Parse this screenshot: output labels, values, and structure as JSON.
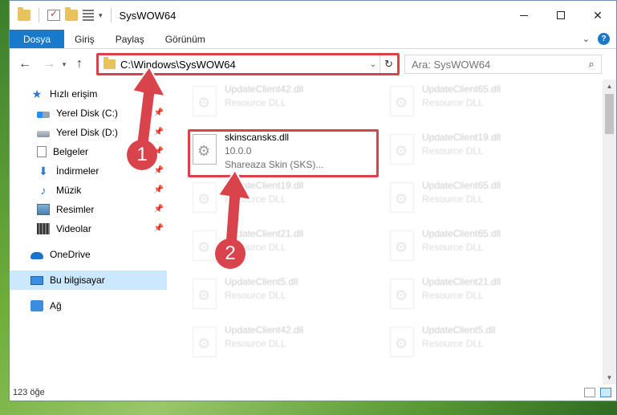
{
  "window": {
    "title": "SysWOW64",
    "controls": {
      "minimize": "–",
      "maximize": "□",
      "close": "✕"
    }
  },
  "ribbon": {
    "tabs": [
      "Dosya",
      "Giriş",
      "Paylaş",
      "Görünüm"
    ],
    "help": "?"
  },
  "address": {
    "path": "C:\\Windows\\SysWOW64",
    "refresh_icon": "↻",
    "search_placeholder": "Ara: SysWOW64"
  },
  "sidebar": {
    "items": [
      {
        "label": "Hızlı erişim",
        "icon": "star-icon"
      },
      {
        "label": "Yerel Disk (C:)",
        "icon": "disk-icon"
      },
      {
        "label": "Yerel Disk (D:)",
        "icon": "disk-icon"
      },
      {
        "label": "Belgeler",
        "icon": "documents-icon"
      },
      {
        "label": "İndirmeler",
        "icon": "downloads-icon"
      },
      {
        "label": "Müzik",
        "icon": "music-icon"
      },
      {
        "label": "Resimler",
        "icon": "pictures-icon"
      },
      {
        "label": "Videolar",
        "icon": "videos-icon"
      },
      {
        "label": "OneDrive",
        "icon": "cloud-icon"
      },
      {
        "label": "Bu bilgisayar",
        "icon": "computer-icon"
      },
      {
        "label": "Ağ",
        "icon": "network-icon"
      }
    ]
  },
  "files": {
    "left_column": [
      {
        "name": "UpdateClient42.dll",
        "type": "Resource DLL"
      },
      {
        "name": "skinscansks.dll",
        "version": "10.0.0",
        "desc": "Shareaza Skin (SKS)..."
      },
      {
        "name": "UpdateClient19.dll",
        "type": "Resource DLL"
      },
      {
        "name": "UpdateClient21.dll",
        "type": "Resource DLL"
      },
      {
        "name": "UpdateClient5.dll",
        "type": "Resource DLL"
      },
      {
        "name": "UpdateClient42.dll",
        "type": "Resource DLL"
      }
    ],
    "right_column": [
      {
        "name": "UpdateClient65.dll",
        "type": "Resource DLL"
      },
      {
        "name": "UpdateClient19.dll",
        "type": "Resource DLL"
      },
      {
        "name": "UpdateClient65.dll",
        "type": "Resource DLL"
      },
      {
        "name": "UpdateClient65.dll",
        "type": "Resource DLL"
      },
      {
        "name": "UpdateClient21.dll",
        "type": "Resource DLL"
      },
      {
        "name": "UpdateClient5.dll",
        "type": "Resource DLL"
      }
    ]
  },
  "status": {
    "count": "123 öğe"
  },
  "annotations": {
    "step1": "1",
    "step2": "2",
    "color": "#d9434b"
  }
}
